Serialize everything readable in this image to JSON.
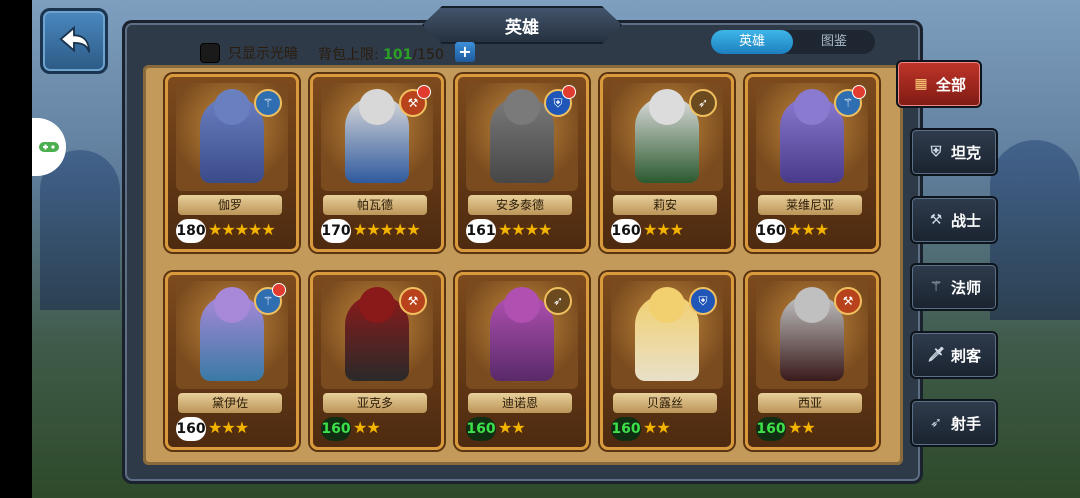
{
  "header": {
    "title": "英雄"
  },
  "top": {
    "only_light_dark_label": "只显示光暗",
    "bag_limit_label": "背包上限:",
    "bag_current": "101",
    "bag_max": "/150",
    "plus_label": "+"
  },
  "tabs": [
    {
      "label": "英雄",
      "active": true
    },
    {
      "label": "图鉴",
      "active": false
    }
  ],
  "filters": [
    {
      "label": "全部",
      "icon": "grid-icon",
      "active": true
    },
    {
      "label": "坦克",
      "icon": "shield-icon"
    },
    {
      "label": "战士",
      "icon": "hammer-icon"
    },
    {
      "label": "法师",
      "icon": "staff-icon"
    },
    {
      "label": "刺客",
      "icon": "dagger-icon"
    },
    {
      "label": "射手",
      "icon": "bow-icon"
    }
  ],
  "heroes": [
    {
      "name": "伽罗",
      "level": "180",
      "stars": "★★★★★",
      "class_icon": "staff-icon",
      "badge_color": "#2f6fb1",
      "notify": false,
      "colors": [
        "#3a4b8a",
        "#6a7fc0"
      ]
    },
    {
      "name": "帕瓦德",
      "level": "170",
      "stars": "★★★★★",
      "class_icon": "hammer-icon",
      "badge_color": "#b8421c",
      "notify": true,
      "colors": [
        "#2f5a9e",
        "#d8d8d8"
      ]
    },
    {
      "name": "安多泰德",
      "level": "161",
      "stars": "★★★★",
      "class_icon": "shield-icon",
      "badge_color": "#1f56b8",
      "notify": true,
      "colors": [
        "#474747",
        "#7a7a7a"
      ]
    },
    {
      "name": "莉安",
      "level": "160",
      "stars": "★★★",
      "class_icon": "bow-icon",
      "badge_color": "#6a4a1e",
      "notify": false,
      "colors": [
        "#2b5a2f",
        "#dcdcdc"
      ]
    },
    {
      "name": "莱维尼亚",
      "level": "160",
      "stars": "★★★",
      "class_icon": "staff-icon",
      "badge_color": "#2f6fb1",
      "notify": true,
      "colors": [
        "#4a3a8a",
        "#8a7ad0"
      ]
    },
    {
      "name": "黛伊佐",
      "level": "160",
      "stars": "★★★",
      "class_icon": "staff-icon",
      "badge_color": "#2f6fb1",
      "notify": true,
      "colors": [
        "#3a7aa5",
        "#a888d8"
      ]
    },
    {
      "name": "亚克多",
      "level": "160",
      "stars": "★★",
      "class_icon": "hammer-icon",
      "badge_color": "#b8421c",
      "notify": false,
      "colors": [
        "#2a2a2a",
        "#8a1a1a"
      ]
    },
    {
      "name": "迪诺恩",
      "level": "160",
      "stars": "★★",
      "class_icon": "bow-icon",
      "badge_color": "#6a4a1e",
      "notify": false,
      "colors": [
        "#5a2a6a",
        "#b050b0"
      ]
    },
    {
      "name": "贝露丝",
      "level": "160",
      "stars": "★★",
      "class_icon": "shield-icon",
      "badge_color": "#1f56b8",
      "notify": false,
      "colors": [
        "#e8e0c8",
        "#f2d070"
      ]
    },
    {
      "name": "西亚",
      "level": "160",
      "stars": "★★",
      "class_icon": "hammer-icon",
      "badge_color": "#b8421c",
      "notify": false,
      "colors": [
        "#3a1a1a",
        "#c0c0c0"
      ]
    }
  ]
}
